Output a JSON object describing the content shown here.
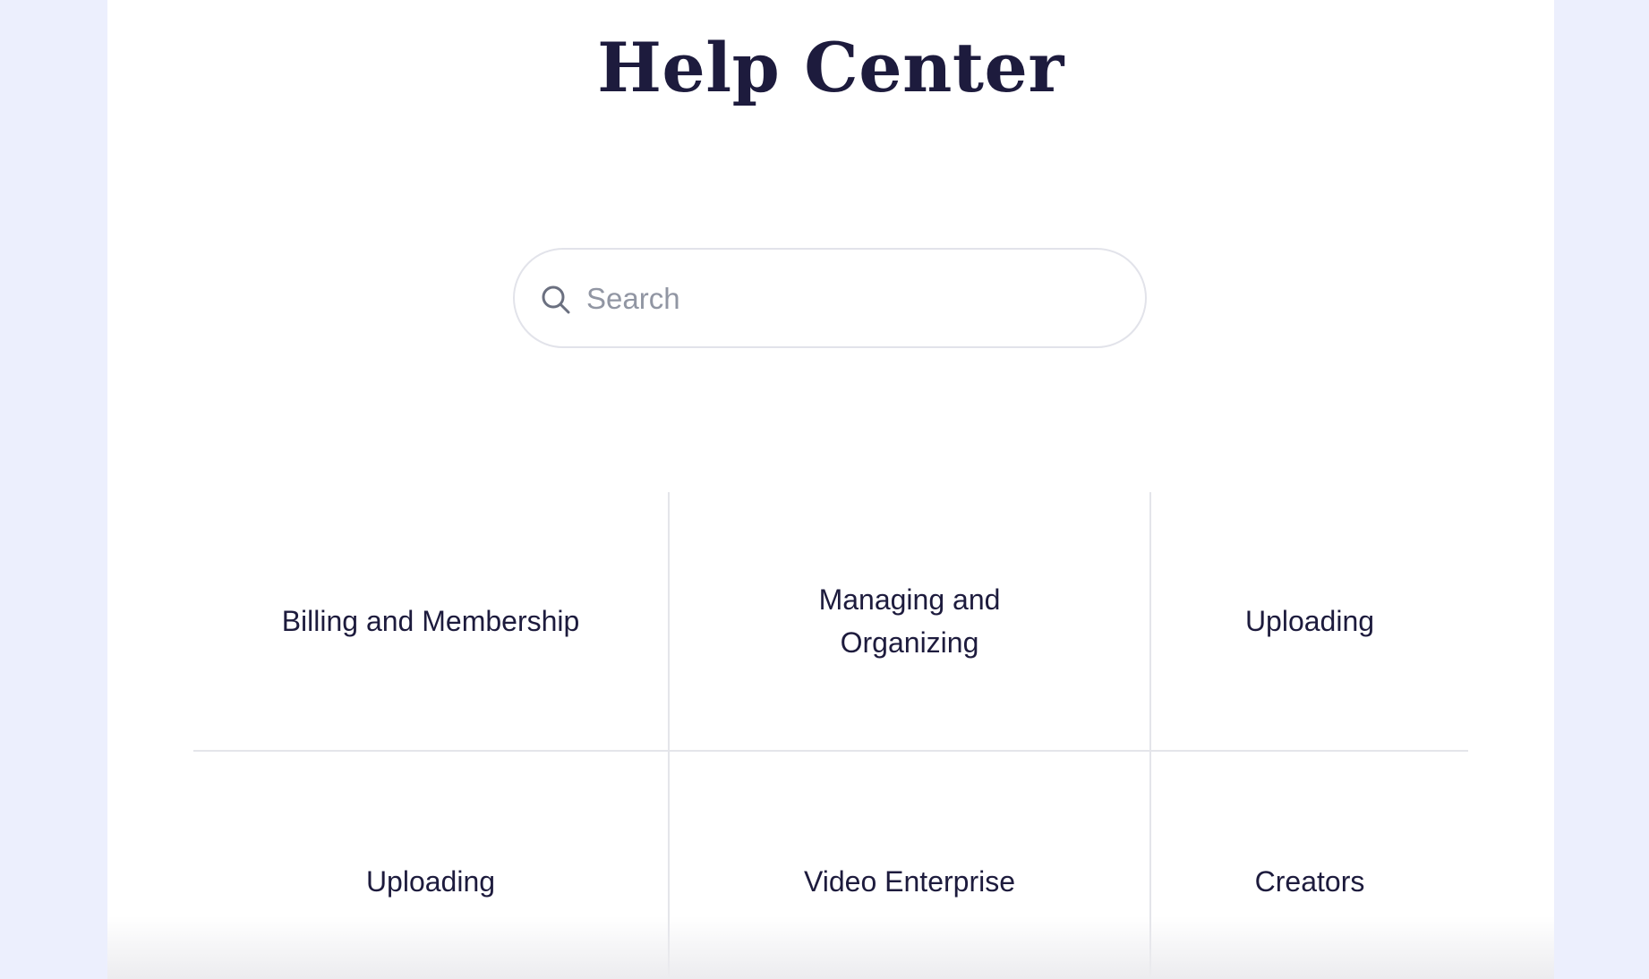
{
  "page": {
    "title": "Help Center"
  },
  "search": {
    "placeholder": "Search",
    "icon": "search-icon"
  },
  "categories": [
    {
      "label": "Billing and Membership"
    },
    {
      "label": "Managing and Organizing"
    },
    {
      "label": "Uploading"
    },
    {
      "label": "Uploading"
    },
    {
      "label": "Video Enterprise"
    },
    {
      "label": "Creators"
    }
  ],
  "colors": {
    "background": "#eceffd",
    "card": "#ffffff",
    "text": "#1d1b3d",
    "placeholder": "#9196a3",
    "border": "#e4e5ea"
  }
}
